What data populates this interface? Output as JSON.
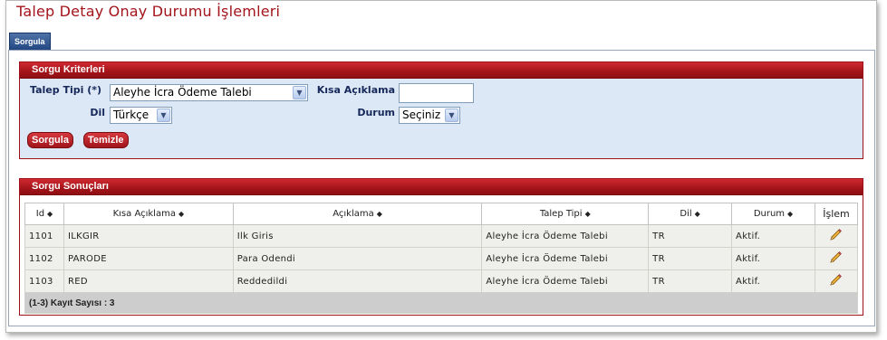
{
  "page": {
    "title": "Talep Detay Onay Durumu İşlemleri"
  },
  "tabs": [
    {
      "label": "Sorgula"
    }
  ],
  "criteria": {
    "header": "Sorgu Kriterleri",
    "talep_tipi_label": "Talep Tipi (*)",
    "talep_tipi_value": "Aleyhe İcra Ödeme Talebi",
    "kisa_aciklama_label": "Kısa Açıklama",
    "kisa_aciklama_value": "",
    "dil_label": "Dil",
    "dil_value": "Türkçe",
    "durum_label": "Durum",
    "durum_value": "Seçiniz",
    "sorgula_button": "Sorgula",
    "temizle_button": "Temizle"
  },
  "results": {
    "header": "Sorgu Sonuçları",
    "columns": [
      "Id",
      "Kısa Açıklama",
      "Açıklama",
      "Talep Tipi",
      "Dil",
      "Durum",
      "İşlem"
    ],
    "rows": [
      {
        "id": "1101",
        "kisa": "ILKGIR",
        "aciklama": "Ilk Giris",
        "talep_tipi": "Aleyhe İcra Ödeme Talebi",
        "dil": "TR",
        "durum": "Aktif."
      },
      {
        "id": "1102",
        "kisa": "PARODE",
        "aciklama": "Para Odendi",
        "talep_tipi": "Aleyhe İcra Ödeme Talebi",
        "dil": "TR",
        "durum": "Aktif."
      },
      {
        "id": "1103",
        "kisa": "RED",
        "aciklama": "Reddedildi",
        "talep_tipi": "Aleyhe İcra Ödeme Talebi",
        "dil": "TR",
        "durum": "Aktif."
      }
    ],
    "footer": "(1-3) Kayıt Sayısı : 3"
  },
  "icons": {
    "sort": "sort-icon",
    "edit": "pencil-icon",
    "dropdown": "chevron-down-icon"
  }
}
